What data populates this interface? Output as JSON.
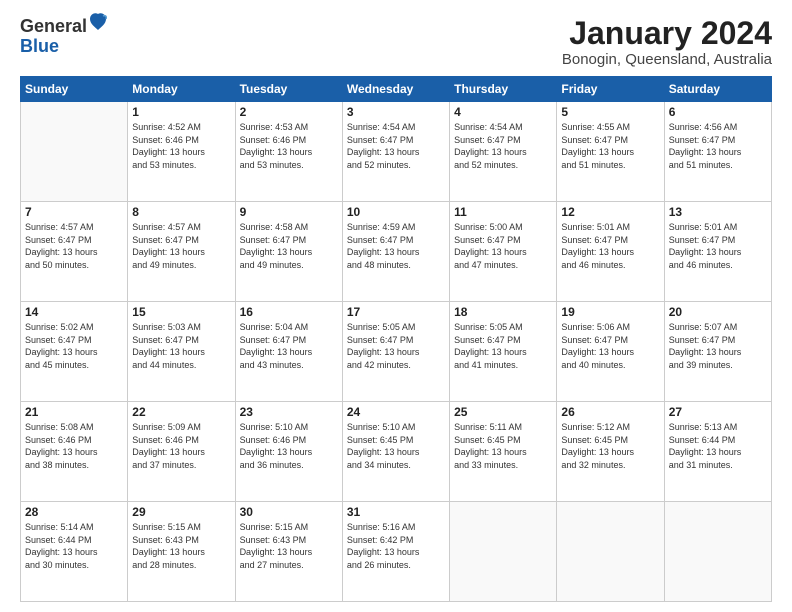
{
  "header": {
    "logo": {
      "line1": "General",
      "line2": "Blue"
    },
    "title": "January 2024",
    "location": "Bonogin, Queensland, Australia"
  },
  "weekdays": [
    "Sunday",
    "Monday",
    "Tuesday",
    "Wednesday",
    "Thursday",
    "Friday",
    "Saturday"
  ],
  "weeks": [
    [
      {
        "day": "",
        "data": ""
      },
      {
        "day": "1",
        "data": "Sunrise: 4:52 AM\nSunset: 6:46 PM\nDaylight: 13 hours\nand 53 minutes."
      },
      {
        "day": "2",
        "data": "Sunrise: 4:53 AM\nSunset: 6:46 PM\nDaylight: 13 hours\nand 53 minutes."
      },
      {
        "day": "3",
        "data": "Sunrise: 4:54 AM\nSunset: 6:47 PM\nDaylight: 13 hours\nand 52 minutes."
      },
      {
        "day": "4",
        "data": "Sunrise: 4:54 AM\nSunset: 6:47 PM\nDaylight: 13 hours\nand 52 minutes."
      },
      {
        "day": "5",
        "data": "Sunrise: 4:55 AM\nSunset: 6:47 PM\nDaylight: 13 hours\nand 51 minutes."
      },
      {
        "day": "6",
        "data": "Sunrise: 4:56 AM\nSunset: 6:47 PM\nDaylight: 13 hours\nand 51 minutes."
      }
    ],
    [
      {
        "day": "7",
        "data": "Sunrise: 4:57 AM\nSunset: 6:47 PM\nDaylight: 13 hours\nand 50 minutes."
      },
      {
        "day": "8",
        "data": "Sunrise: 4:57 AM\nSunset: 6:47 PM\nDaylight: 13 hours\nand 49 minutes."
      },
      {
        "day": "9",
        "data": "Sunrise: 4:58 AM\nSunset: 6:47 PM\nDaylight: 13 hours\nand 49 minutes."
      },
      {
        "day": "10",
        "data": "Sunrise: 4:59 AM\nSunset: 6:47 PM\nDaylight: 13 hours\nand 48 minutes."
      },
      {
        "day": "11",
        "data": "Sunrise: 5:00 AM\nSunset: 6:47 PM\nDaylight: 13 hours\nand 47 minutes."
      },
      {
        "day": "12",
        "data": "Sunrise: 5:01 AM\nSunset: 6:47 PM\nDaylight: 13 hours\nand 46 minutes."
      },
      {
        "day": "13",
        "data": "Sunrise: 5:01 AM\nSunset: 6:47 PM\nDaylight: 13 hours\nand 46 minutes."
      }
    ],
    [
      {
        "day": "14",
        "data": "Sunrise: 5:02 AM\nSunset: 6:47 PM\nDaylight: 13 hours\nand 45 minutes."
      },
      {
        "day": "15",
        "data": "Sunrise: 5:03 AM\nSunset: 6:47 PM\nDaylight: 13 hours\nand 44 minutes."
      },
      {
        "day": "16",
        "data": "Sunrise: 5:04 AM\nSunset: 6:47 PM\nDaylight: 13 hours\nand 43 minutes."
      },
      {
        "day": "17",
        "data": "Sunrise: 5:05 AM\nSunset: 6:47 PM\nDaylight: 13 hours\nand 42 minutes."
      },
      {
        "day": "18",
        "data": "Sunrise: 5:05 AM\nSunset: 6:47 PM\nDaylight: 13 hours\nand 41 minutes."
      },
      {
        "day": "19",
        "data": "Sunrise: 5:06 AM\nSunset: 6:47 PM\nDaylight: 13 hours\nand 40 minutes."
      },
      {
        "day": "20",
        "data": "Sunrise: 5:07 AM\nSunset: 6:47 PM\nDaylight: 13 hours\nand 39 minutes."
      }
    ],
    [
      {
        "day": "21",
        "data": "Sunrise: 5:08 AM\nSunset: 6:46 PM\nDaylight: 13 hours\nand 38 minutes."
      },
      {
        "day": "22",
        "data": "Sunrise: 5:09 AM\nSunset: 6:46 PM\nDaylight: 13 hours\nand 37 minutes."
      },
      {
        "day": "23",
        "data": "Sunrise: 5:10 AM\nSunset: 6:46 PM\nDaylight: 13 hours\nand 36 minutes."
      },
      {
        "day": "24",
        "data": "Sunrise: 5:10 AM\nSunset: 6:45 PM\nDaylight: 13 hours\nand 34 minutes."
      },
      {
        "day": "25",
        "data": "Sunrise: 5:11 AM\nSunset: 6:45 PM\nDaylight: 13 hours\nand 33 minutes."
      },
      {
        "day": "26",
        "data": "Sunrise: 5:12 AM\nSunset: 6:45 PM\nDaylight: 13 hours\nand 32 minutes."
      },
      {
        "day": "27",
        "data": "Sunrise: 5:13 AM\nSunset: 6:44 PM\nDaylight: 13 hours\nand 31 minutes."
      }
    ],
    [
      {
        "day": "28",
        "data": "Sunrise: 5:14 AM\nSunset: 6:44 PM\nDaylight: 13 hours\nand 30 minutes."
      },
      {
        "day": "29",
        "data": "Sunrise: 5:15 AM\nSunset: 6:43 PM\nDaylight: 13 hours\nand 28 minutes."
      },
      {
        "day": "30",
        "data": "Sunrise: 5:15 AM\nSunset: 6:43 PM\nDaylight: 13 hours\nand 27 minutes."
      },
      {
        "day": "31",
        "data": "Sunrise: 5:16 AM\nSunset: 6:42 PM\nDaylight: 13 hours\nand 26 minutes."
      },
      {
        "day": "",
        "data": ""
      },
      {
        "day": "",
        "data": ""
      },
      {
        "day": "",
        "data": ""
      }
    ]
  ]
}
